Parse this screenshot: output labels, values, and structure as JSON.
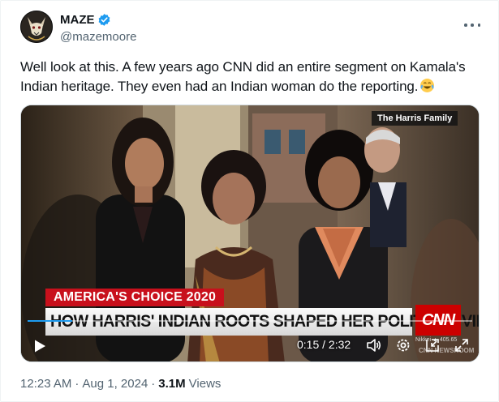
{
  "author": {
    "display_name": "MAZE",
    "handle": "@mazemoore",
    "verified": true,
    "avatar_icon": "wolf-avatar-icon"
  },
  "tweet": {
    "text": "Well look at this. A few years ago CNN did an entire segment on Kamala's Indian heritage. They even had an Indian woman do the reporting.",
    "emoji": "face-with-tears-of-joy"
  },
  "video": {
    "corner_label": "The Harris Family",
    "banner_top": "AMERICA'S CHOICE 2020",
    "banner_main": "HOW HARRIS' INDIAN ROOTS SHAPED HER POLITICAL VIEWS",
    "network_logo": "CNN",
    "ticker": "Nikkei ▲ 405.65",
    "watermark": "CNN NEWSROOM",
    "current_time": "0:15",
    "duration": "2:32",
    "time_display": "0:15 / 2:32",
    "progress": 0.1
  },
  "footer": {
    "time": "12:23 AM",
    "date": "Aug 1, 2024",
    "views_count": "3.1M",
    "views_label": "Views"
  },
  "colors": {
    "accent": "#1d9bf0",
    "cnn_red": "#cc0000",
    "text_secondary": "#536471"
  }
}
